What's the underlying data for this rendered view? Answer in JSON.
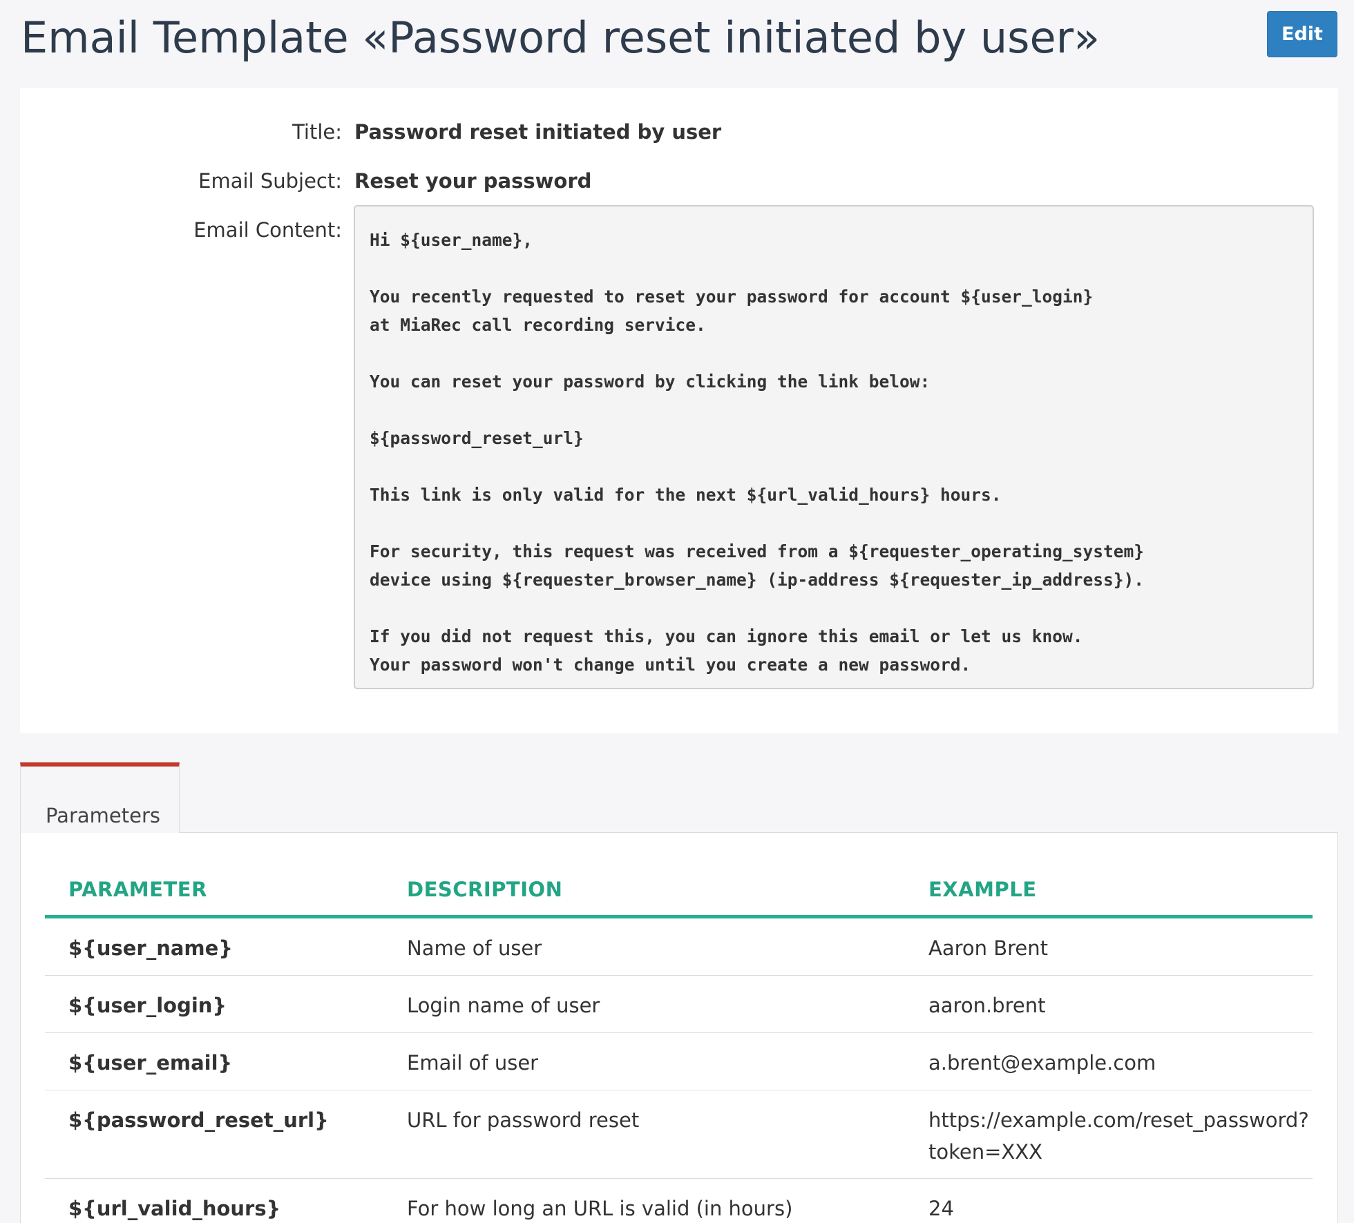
{
  "header": {
    "title": "Email Template «Password reset initiated by user»",
    "edit_label": "Edit"
  },
  "details": {
    "title_label": "Title:",
    "title_value": "Password reset initiated by user",
    "subject_label": "Email Subject:",
    "subject_value": "Reset your password",
    "content_label": "Email Content:",
    "content_lines": [
      "Hi ${user_name},",
      "",
      "You recently requested to reset your password for account ${user_login}",
      "at MiaRec call recording service.",
      "",
      "You can reset your password by clicking the link below:",
      "",
      "${password_reset_url}",
      "",
      "This link is only valid for the next ${url_valid_hours} hours.",
      "",
      "For security, this request was received from a ${requester_operating_system}",
      "device using ${requester_browser_name} (ip-address ${requester_ip_address}).",
      "",
      "If you did not request this, you can ignore this email or let us know.",
      "Your password won't change until you create a new password."
    ]
  },
  "tabs": [
    {
      "label": "Parameters",
      "active": true
    }
  ],
  "params_table": {
    "columns": [
      "PARAMETER",
      "DESCRIPTION",
      "EXAMPLE"
    ],
    "rows": [
      {
        "parameter": "${user_name}",
        "description": "Name of user",
        "example": "Aaron Brent"
      },
      {
        "parameter": "${user_login}",
        "description": "Login name of user",
        "example": "aaron.brent"
      },
      {
        "parameter": "${user_email}",
        "description": "Email of user",
        "example": "a.brent@example.com"
      },
      {
        "parameter": "${password_reset_url}",
        "description": "URL for password reset",
        "example": "https://example.com/reset_password? token=XXX"
      },
      {
        "parameter": "${url_valid_hours}",
        "description": "For how long an URL is valid (in hours)",
        "example": "24"
      }
    ]
  },
  "colors": {
    "title": "#2e3b4c",
    "edit_button": "#2f80c0",
    "tab_accent": "#c0392b",
    "table_header": "#23a585",
    "table_header_rule": "#27b08f"
  }
}
